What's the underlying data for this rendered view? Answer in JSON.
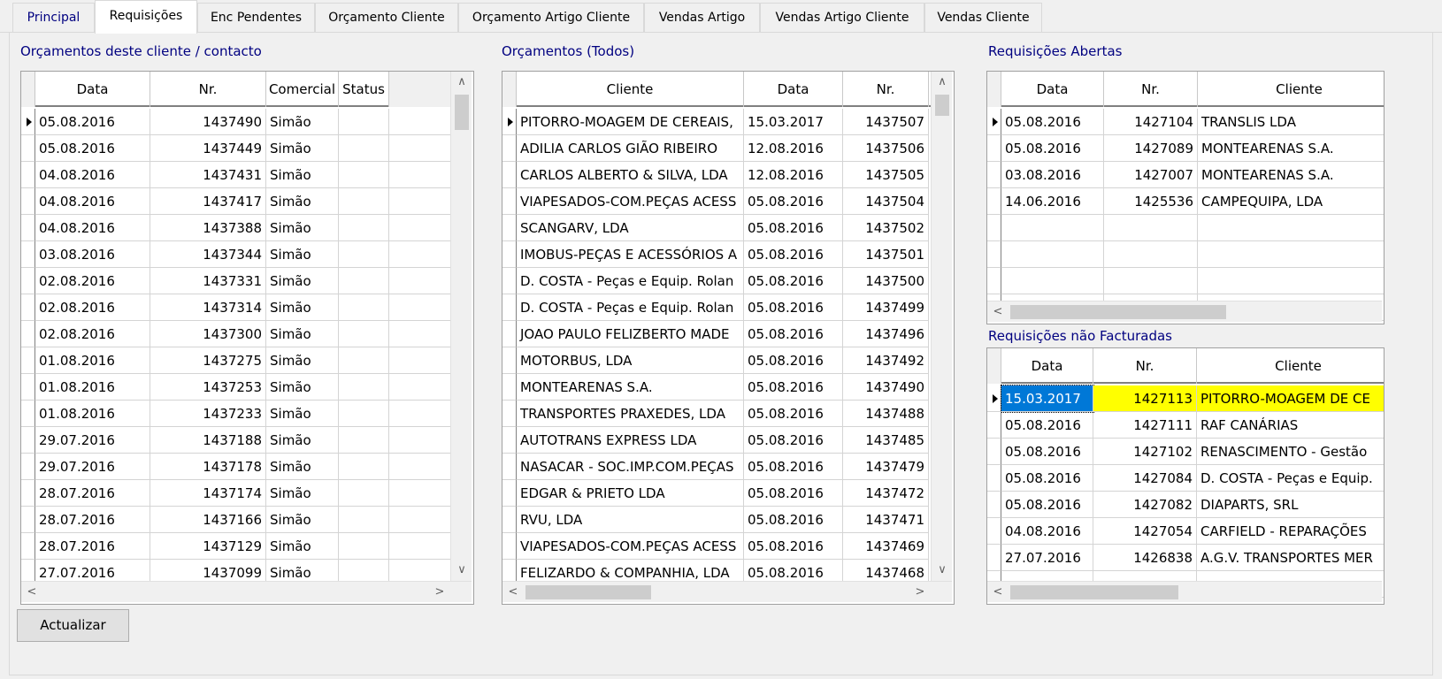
{
  "tabs": [
    "Principal",
    "Requisições",
    "Enc Pendentes",
    "Orçamento Cliente",
    "Orçamento Artigo Cliente",
    "Vendas Artigo",
    "Vendas Artigo Cliente",
    "Vendas Cliente"
  ],
  "sections": {
    "orc_cliente": "Orçamentos deste cliente / contacto",
    "orc_todos": "Orçamentos (Todos)",
    "req_abertas": "Requisições Abertas",
    "req_nao_fact": "Requisições não Facturadas"
  },
  "grid1": {
    "headers": [
      "Data",
      "Nr.",
      "Comercial",
      "Status"
    ],
    "rows": [
      [
        "05.08.2016",
        "1437490",
        "Simão",
        ""
      ],
      [
        "05.08.2016",
        "1437449",
        "Simão",
        ""
      ],
      [
        "04.08.2016",
        "1437431",
        "Simão",
        ""
      ],
      [
        "04.08.2016",
        "1437417",
        "Simão",
        ""
      ],
      [
        "04.08.2016",
        "1437388",
        "Simão",
        ""
      ],
      [
        "03.08.2016",
        "1437344",
        "Simão",
        ""
      ],
      [
        "02.08.2016",
        "1437331",
        "Simão",
        ""
      ],
      [
        "02.08.2016",
        "1437314",
        "Simão",
        ""
      ],
      [
        "02.08.2016",
        "1437300",
        "Simão",
        ""
      ],
      [
        "01.08.2016",
        "1437275",
        "Simão",
        ""
      ],
      [
        "01.08.2016",
        "1437253",
        "Simão",
        ""
      ],
      [
        "01.08.2016",
        "1437233",
        "Simão",
        ""
      ],
      [
        "29.07.2016",
        "1437188",
        "Simão",
        ""
      ],
      [
        "29.07.2016",
        "1437178",
        "Simão",
        ""
      ],
      [
        "28.07.2016",
        "1437174",
        "Simão",
        ""
      ],
      [
        "28.07.2016",
        "1437166",
        "Simão",
        ""
      ],
      [
        "28.07.2016",
        "1437129",
        "Simão",
        ""
      ],
      [
        "27.07.2016",
        "1437099",
        "Simão",
        ""
      ]
    ]
  },
  "grid2": {
    "headers": [
      "Cliente",
      "Data",
      "Nr."
    ],
    "rows": [
      [
        "PITORRO-MOAGEM DE CEREAIS,",
        "15.03.2017",
        "1437507"
      ],
      [
        "ADILIA CARLOS GIÃO RIBEIRO",
        "12.08.2016",
        "1437506"
      ],
      [
        "CARLOS ALBERTO & SILVA, LDA",
        "12.08.2016",
        "1437505"
      ],
      [
        "VIAPESADOS-COM.PEÇAS ACESS",
        "05.08.2016",
        "1437504"
      ],
      [
        "SCANGARV, LDA",
        "05.08.2016",
        "1437502"
      ],
      [
        "IMOBUS-PEÇAS E ACESSÓRIOS A",
        "05.08.2016",
        "1437501"
      ],
      [
        "D. COSTA - Peças e Equip. Rolan",
        "05.08.2016",
        "1437500"
      ],
      [
        "D. COSTA - Peças e Equip. Rolan",
        "05.08.2016",
        "1437499"
      ],
      [
        "JOAO PAULO FELIZBERTO MADE",
        "05.08.2016",
        "1437496"
      ],
      [
        "MOTORBUS, LDA",
        "05.08.2016",
        "1437492"
      ],
      [
        "MONTEARENAS S.A.",
        "05.08.2016",
        "1437490"
      ],
      [
        "TRANSPORTES PRAXEDES, LDA",
        "05.08.2016",
        "1437488"
      ],
      [
        "AUTOTRANS EXPRESS LDA",
        "05.08.2016",
        "1437485"
      ],
      [
        "NASACAR - SOC.IMP.COM.PEÇAS",
        "05.08.2016",
        "1437479"
      ],
      [
        "EDGAR & PRIETO LDA",
        "05.08.2016",
        "1437472"
      ],
      [
        "RVU, LDA",
        "05.08.2016",
        "1437471"
      ],
      [
        "VIAPESADOS-COM.PEÇAS ACESS",
        "05.08.2016",
        "1437469"
      ],
      [
        "FELIZARDO & COMPANHIA, LDA",
        "05.08.2016",
        "1437468"
      ]
    ]
  },
  "grid3": {
    "headers": [
      "Data",
      "Nr.",
      "Cliente"
    ],
    "rows": [
      [
        "05.08.2016",
        "1427104",
        "TRANSLIS LDA"
      ],
      [
        "05.08.2016",
        "1427089",
        "MONTEARENAS S.A."
      ],
      [
        "03.08.2016",
        "1427007",
        "MONTEARENAS S.A."
      ],
      [
        "14.06.2016",
        "1425536",
        "CAMPEQUIPA, LDA"
      ]
    ]
  },
  "grid4": {
    "headers": [
      "Data",
      "Nr.",
      "Cliente"
    ],
    "rows": [
      [
        "15.03.2017",
        "1427113",
        "PITORRO-MOAGEM DE CE"
      ],
      [
        "05.08.2016",
        "1427111",
        "RAF CANÁRIAS"
      ],
      [
        "05.08.2016",
        "1427102",
        "RENASCIMENTO - Gestão"
      ],
      [
        "05.08.2016",
        "1427084",
        "D. COSTA - Peças e Equip."
      ],
      [
        "05.08.2016",
        "1427082",
        "DIAPARTS, SRL"
      ],
      [
        "04.08.2016",
        "1427054",
        "CARFIELD - REPARAÇÕES"
      ],
      [
        "27.07.2016",
        "1426838",
        "A.G.V. TRANSPORTES MER"
      ]
    ]
  },
  "button": "Actualizar",
  "colors": {
    "title": "#000080",
    "highlight": "#ffff00",
    "selection": "#0078d7"
  }
}
